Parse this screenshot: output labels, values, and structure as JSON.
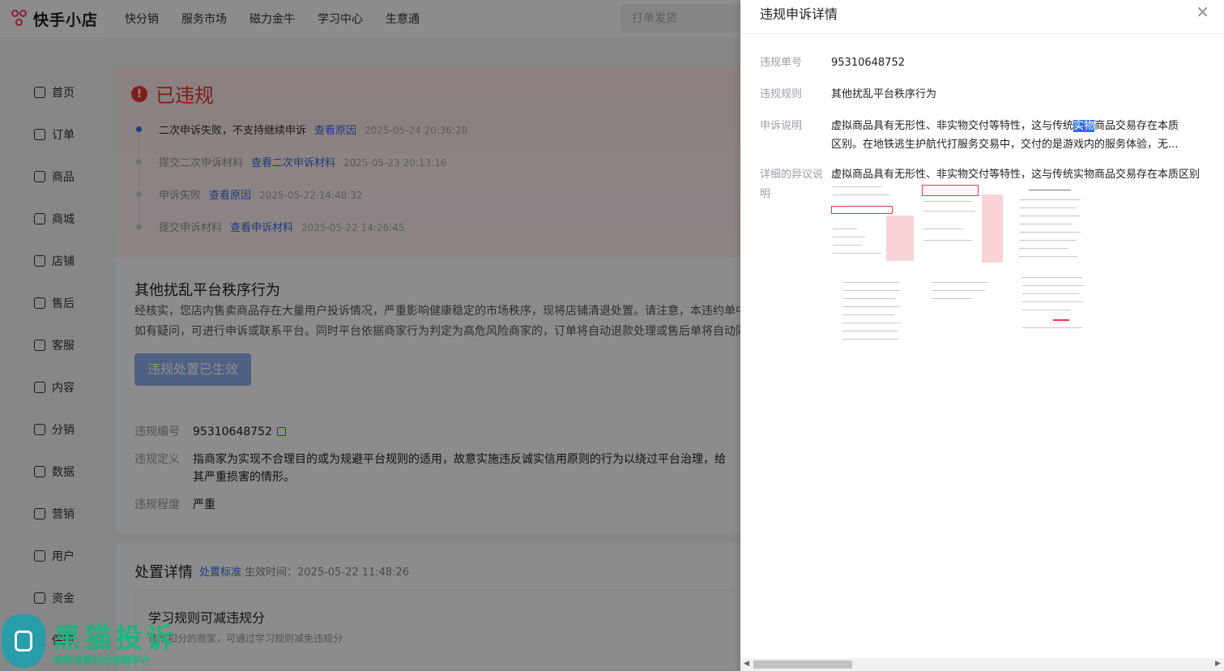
{
  "topbar": {
    "brand": "快手小店",
    "nav": [
      "快分销",
      "服务市场",
      "磁力金牛",
      "学习中心",
      "生意通"
    ],
    "search_placeholder": "打单发货"
  },
  "sidebar": {
    "items": [
      "首页",
      "订单",
      "商品",
      "商城",
      "店铺",
      "售后",
      "客服",
      "内容",
      "分销",
      "数据",
      "营销",
      "用户",
      "资金",
      "保障"
    ]
  },
  "status": {
    "title": "已违规",
    "timeline": [
      {
        "text": "二次申诉失败，不支持继续申诉",
        "link": "查看原因",
        "time": "2025-05-24 20:36:28",
        "active": true
      },
      {
        "text": "提交二次申诉材料",
        "link": "查看二次申诉材料",
        "time": "2025-05-23 20:13:16",
        "active": false
      },
      {
        "text": "申诉失败",
        "link": "查看原因",
        "time": "2025-05-22 14:48:32",
        "active": false
      },
      {
        "text": "提交申诉材料",
        "link": "查看申诉材料",
        "time": "2025-05-22 14:26:45",
        "active": false
      }
    ]
  },
  "violation": {
    "title": "其他扰乱平台秩序行为",
    "desc_line1": "经核实，您店内售卖商品存在大量用户投诉情况，严重影响健康稳定的市场秩序，现将店铺清退处置。请注意，本违约单中",
    "desc_line2": "如有疑问，可进行申诉或联系平台。同时平台依据商家行为判定为高危风险商家的，订单将自动退款处理或售后单将自动同",
    "button": "违规处置已生效",
    "id_label": "违规编号",
    "id_value": "95310648752",
    "def_label": "违规定义",
    "def_value_1": "指商家为实现不合理目的或为规避平台规则的适用，故意实施违反诚实信用原则的行为以绕过平台治理，给",
    "def_value_2": "其严重损害的情形。",
    "level_label": "违规程度",
    "level_value": "严重"
  },
  "disposal": {
    "title": "处置详情",
    "standard_link": "处置标准",
    "effective": "生效时间：2025-05-22 11:48:26",
    "learn_title": "学习规则可减违规分",
    "learn_desc": "违规扣分的商家，可通过学习规则减免违规分"
  },
  "watermark": {
    "big": "黑猫投诉",
    "small": "网络消费纠纷调解平台"
  },
  "drawer": {
    "title": "违规申诉详情",
    "close": "×",
    "order_label": "违规单号",
    "order_value": "95310648752",
    "rule_label": "违规规则",
    "rule_value": "其他扰乱平台秩序行为",
    "explain_label": "申诉说明",
    "explain_pre": "虚拟商品具有无形性、非实物交付等特性，这与传统",
    "explain_hl": "实物",
    "explain_post": "商品交易存在本质",
    "explain_line2": "区别。在地铁逃生护航代打服务交易中，交付的是游戏内的服务体验，无...",
    "detail_label": "详细的异议说明",
    "detail_value": "虚拟商品具有无形性、非实物交付等特性，这与传统实物商品交易存在本质区别"
  }
}
